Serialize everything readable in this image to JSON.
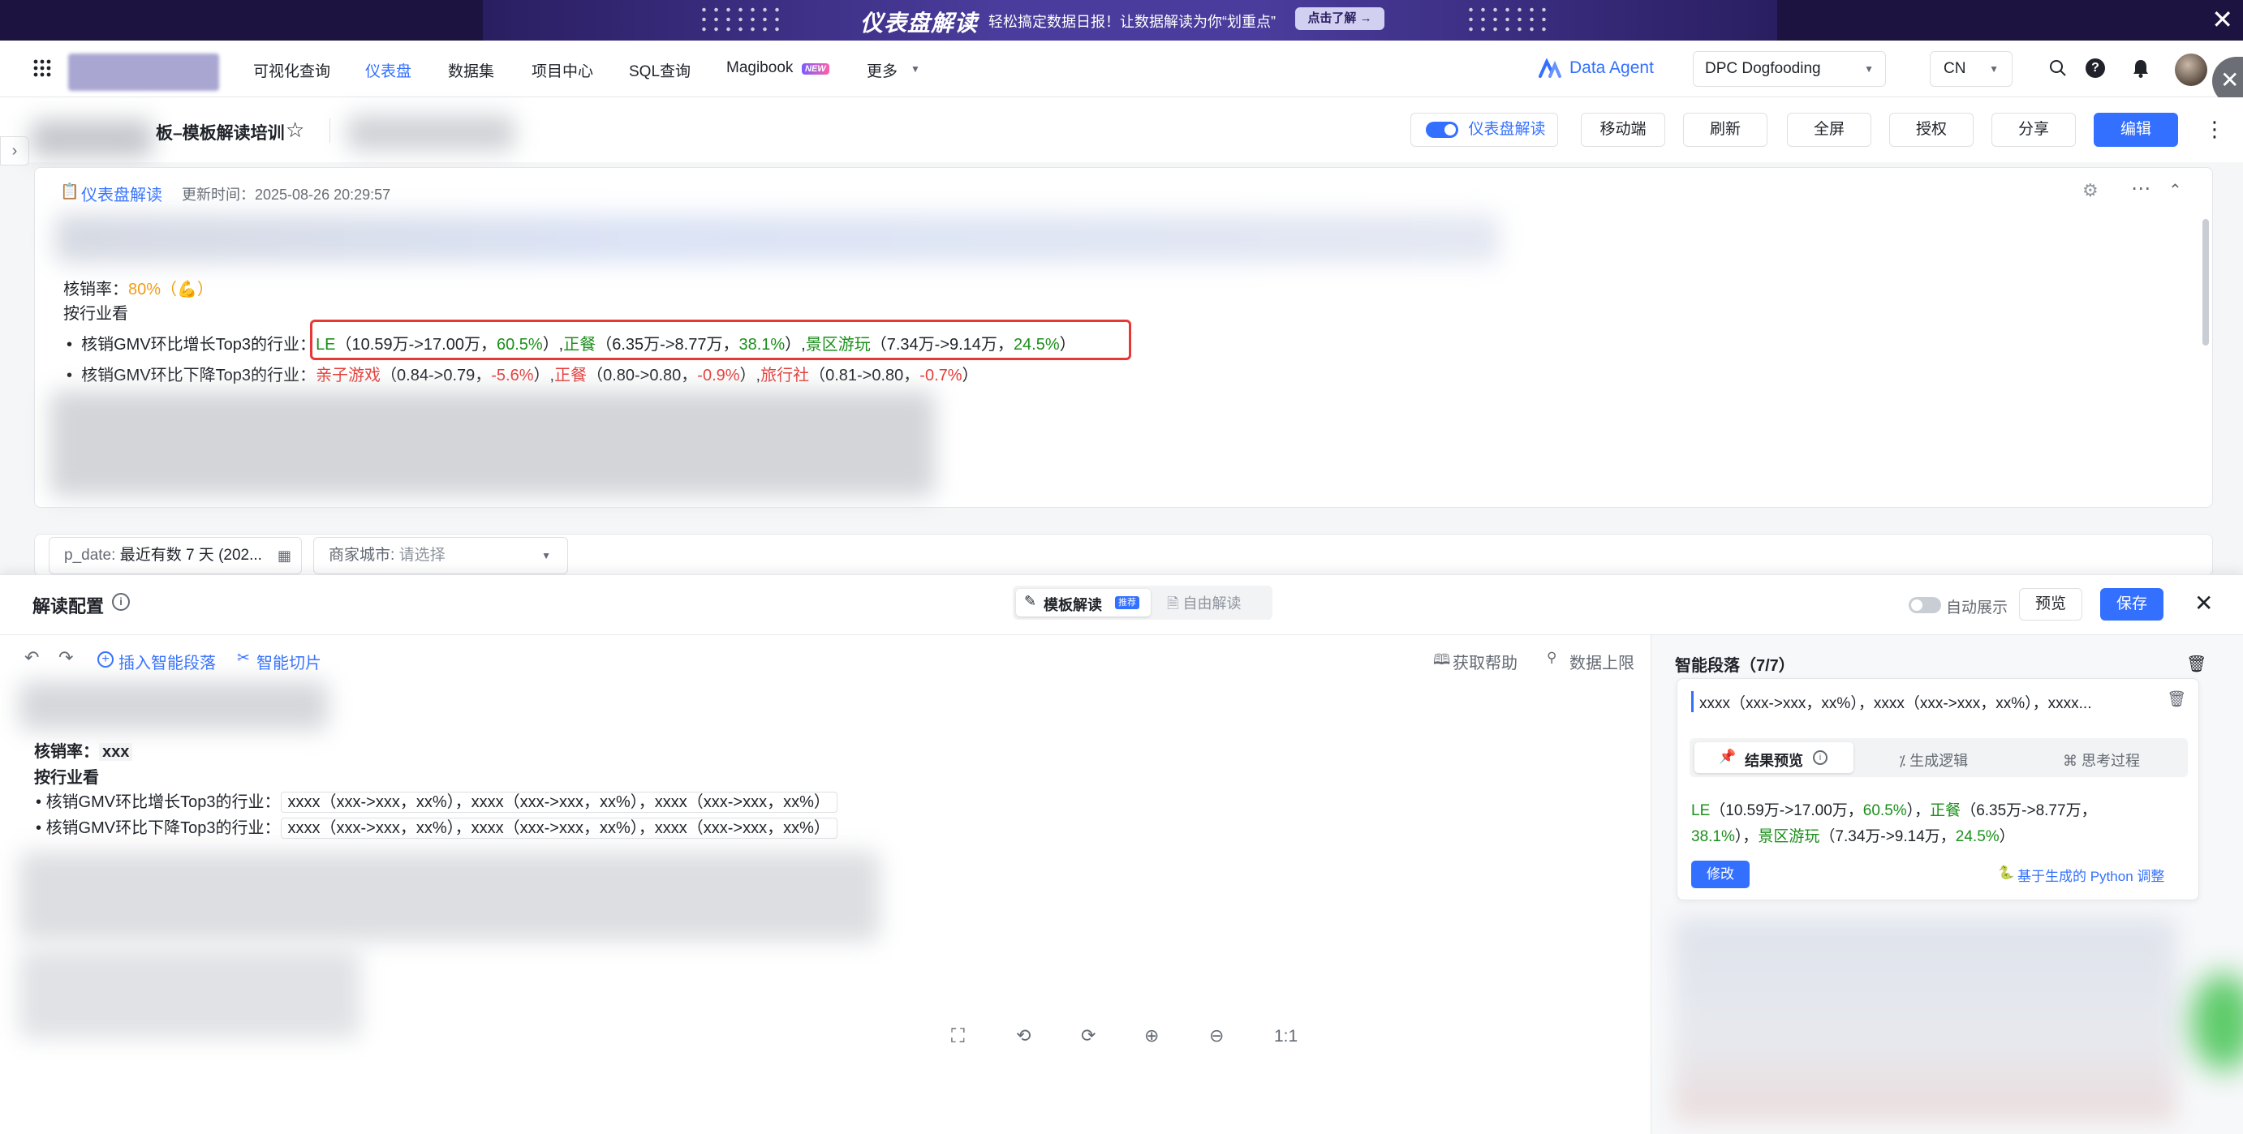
{
  "banner": {
    "title": "仪表盘解读",
    "subtitle": "轻松搞定数据日报！让数据解读为你“划重点”",
    "button": "点击了解 →",
    "close": "✕"
  },
  "nav": {
    "items": [
      "可视化查询",
      "仪表盘",
      "数据集",
      "项目中心",
      "SQL查询",
      "Magibook",
      "更多"
    ],
    "magibook_badge": "NEW",
    "data_agent": "Data Agent",
    "workspace": "DPC Dogfooding",
    "language": "CN"
  },
  "dashboard": {
    "title": "板–模板解读培训",
    "toggle_label": "仪表盘解读",
    "buttons": [
      "移动端",
      "刷新",
      "全屏",
      "授权",
      "分享"
    ],
    "edit_button": "编辑"
  },
  "card": {
    "title": "仪表盘解读",
    "updated": "更新时间：2025-08-26 20:29:57",
    "rate_label": "核销率：",
    "rate_value": "80%（💪）",
    "by_industry": "按行业看",
    "grow_label": "核销GMV环比增长Top3的行业：",
    "grow": [
      {
        "name": "LE",
        "detail": "（10.59万->17.00万，",
        "pct": "60.5%",
        "close": "）,"
      },
      {
        "name": "正餐",
        "detail": "（6.35万->8.77万，",
        "pct": "38.1%",
        "close": "）,"
      },
      {
        "name": "景区游玩",
        "detail": "（7.34万->9.14万，",
        "pct": "24.5%",
        "close": "）"
      }
    ],
    "drop_label": "核销GMV环比下降Top3的行业：",
    "drop": [
      {
        "name": "亲子游戏",
        "detail": "（0.84->0.79，",
        "pct": "-5.6%",
        "close": "）,"
      },
      {
        "name": "正餐",
        "detail": "（0.80->0.80，",
        "pct": "-0.9%",
        "close": "）,"
      },
      {
        "name": "旅行社",
        "detail": "（0.81->0.80，",
        "pct": "-0.7%",
        "close": "）"
      }
    ]
  },
  "filters": {
    "date_label": "p_date:",
    "date_value": "最近有数 7 天 (202...",
    "city_label": "商家城市:",
    "city_placeholder": "请选择"
  },
  "config": {
    "title": "解读配置",
    "tab_template": "模板解读",
    "tab_template_badge": "推荐",
    "tab_free": "自由解读",
    "auto_show": "自动展示",
    "preview": "预览",
    "save": "保存",
    "insert_segment": "插入智能段落",
    "smart_slice": "智能切片",
    "get_help": "获取帮助",
    "data_limit": "数据上限",
    "editor": {
      "rate_label": "核销率：",
      "rate_value": "xxx",
      "by_industry": "按行业看",
      "grow_label": "核销GMV环比增长Top3的行业：",
      "drop_label": "核销GMV环比下降Top3的行业：",
      "placeholder": "xxxx（xxx->xxx，xx%），xxxx（xxx->xxx，xx%），xxxx（xxx->xxx，xx%）"
    },
    "zoom_actual": "1:1"
  },
  "right": {
    "title": "智能段落（7/7）",
    "segment_text": "xxxx（xxx->xxx，xx%），xxxx（xxx->xxx，xx%），xxxx...",
    "tabs": [
      "结果预览",
      "生成逻辑",
      "思考过程"
    ],
    "result_parts": [
      {
        "t": "LE",
        "c": "green"
      },
      {
        "t": "（10.59万->17.00万，",
        "c": ""
      },
      {
        "t": "60.5%",
        "c": "green"
      },
      {
        "t": "），",
        "c": ""
      },
      {
        "t": "正餐",
        "c": "green"
      },
      {
        "t": "（6.35万->8.77万，",
        "c": ""
      }
    ],
    "result_line2_parts": [
      {
        "t": "38.1%",
        "c": "green"
      },
      {
        "t": "），",
        "c": ""
      },
      {
        "t": "景区游玩",
        "c": "green"
      },
      {
        "t": "（7.34万->9.14万，",
        "c": ""
      },
      {
        "t": "24.5%",
        "c": "green"
      },
      {
        "t": "）",
        "c": ""
      }
    ],
    "modify": "修改",
    "python_adjust": "基于生成的 Python 调整"
  },
  "colors": {
    "accent": "#3370ff",
    "green": "#1a8f1a",
    "red": "#e53935",
    "highlight_border": "#e53935",
    "banner_bg": "#1d1340"
  }
}
